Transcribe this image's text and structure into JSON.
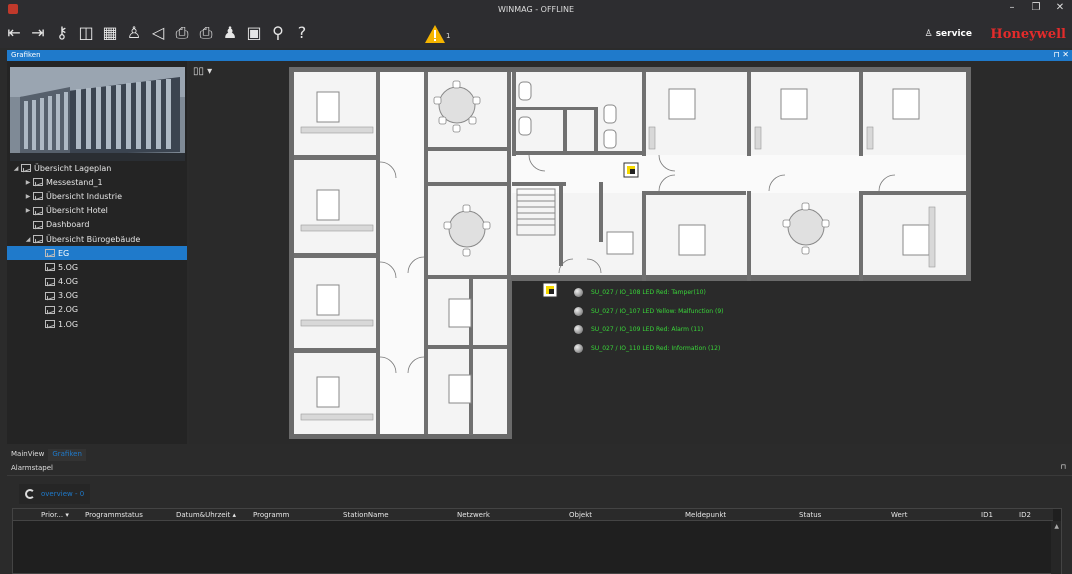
{
  "window": {
    "title": "WINMAG - OFFLINE",
    "controls": [
      "–",
      "❐",
      "✕"
    ]
  },
  "toolbar": {
    "icons": [
      "login-icon",
      "logout-icon",
      "key-icon",
      "chart-icon",
      "grid-icon",
      "user-switch-icon",
      "mute-icon",
      "print-icon",
      "print-preview-icon",
      "users-icon",
      "calendar-icon",
      "network-icon",
      "help-icon"
    ],
    "warning_count": "1",
    "user": "service",
    "brand": "Honeywell"
  },
  "panel": {
    "title": "Grafiken",
    "controls": "⊓ ✕"
  },
  "tree": [
    {
      "label": "Übersicht Lageplan",
      "level": 0,
      "arrow": "◢",
      "selected": false
    },
    {
      "label": "Messestand_1",
      "level": 1,
      "arrow": "▶",
      "selected": false
    },
    {
      "label": "Übersicht Industrie",
      "level": 1,
      "arrow": "▶",
      "selected": false
    },
    {
      "label": "Übersicht Hotel",
      "level": 1,
      "arrow": "▶",
      "selected": false
    },
    {
      "label": "Dashboard",
      "level": 1,
      "arrow": "",
      "selected": false
    },
    {
      "label": "Übersicht Bürogebäude",
      "level": 1,
      "arrow": "◢",
      "selected": false
    },
    {
      "label": "EG",
      "level": 2,
      "arrow": "",
      "selected": true
    },
    {
      "label": "5.OG",
      "level": 2,
      "arrow": "",
      "selected": false
    },
    {
      "label": "4.OG",
      "level": 2,
      "arrow": "",
      "selected": false
    },
    {
      "label": "3.OG",
      "level": 2,
      "arrow": "",
      "selected": false
    },
    {
      "label": "2.OG",
      "level": 2,
      "arrow": "",
      "selected": false
    },
    {
      "label": "1.OG",
      "level": 2,
      "arrow": "",
      "selected": false
    }
  ],
  "canvas": {
    "map_toggle": "▯▯ ▾",
    "leds": [
      "SU_027 / IO_108 LED Red: Tamper(10)",
      "SU_027 / IO_107 LED Yellow: Malfunction (9)",
      "SU_027 / IO_109 LED Red: Alarm (11)",
      "SU_027 / IO_110 LED Red: Information (12)"
    ]
  },
  "bottom_tabs": [
    "MainView",
    "Grafiken"
  ],
  "alarm": {
    "title": "Alarmstapel",
    "pin": "⊓",
    "overview_label": "overview - 0",
    "columns": [
      "Prior... ▾",
      "Programmstatus",
      "Datum&Uhrzeit ▴",
      "Programm",
      "StationName",
      "Netzwerk",
      "Objekt",
      "Meldepunkt",
      "Status",
      "Wert",
      "ID1",
      "ID2"
    ],
    "scroll_up": "▲"
  },
  "colors": {
    "accent": "#1f7acb",
    "brand": "#e32b2b",
    "led_text": "#39d739"
  }
}
